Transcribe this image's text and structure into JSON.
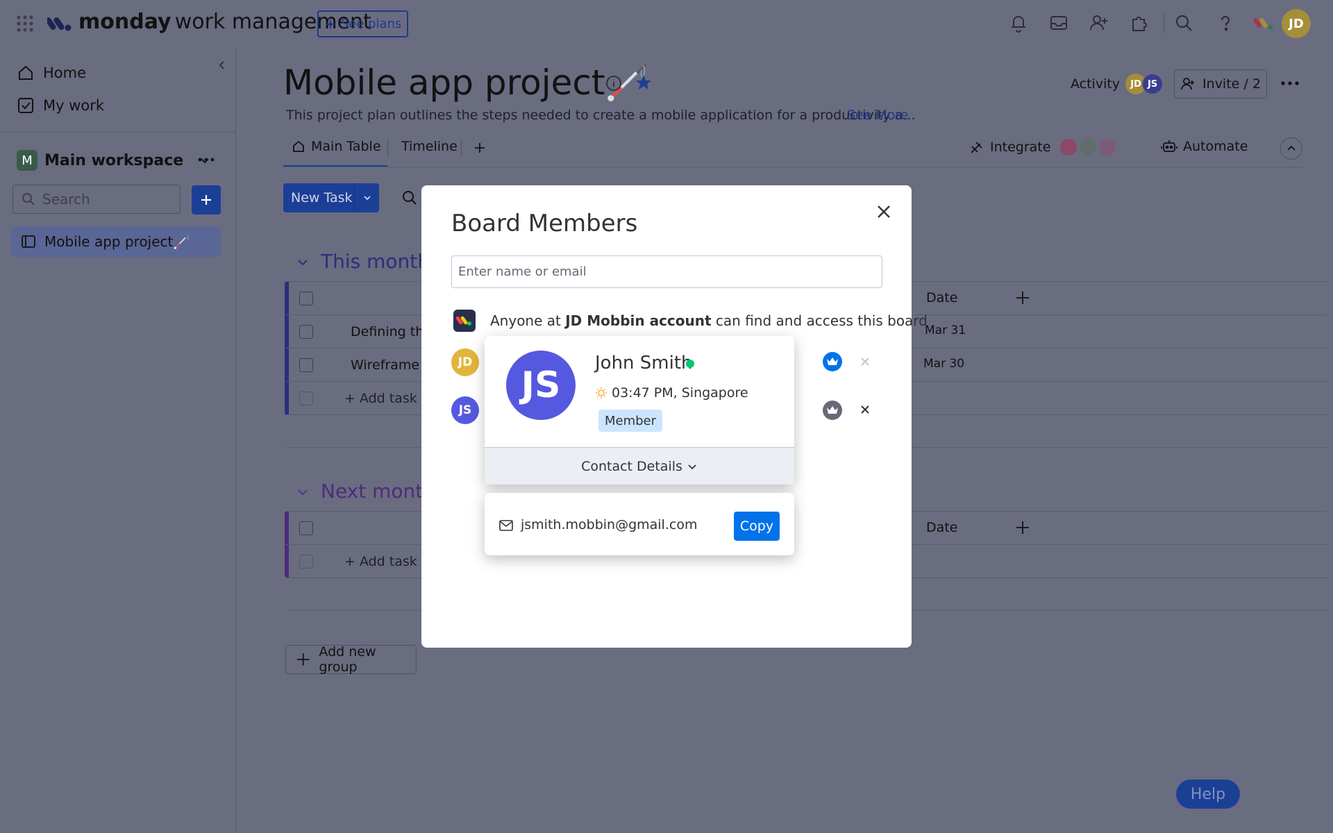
{
  "topbar": {
    "brand_bold": "monday",
    "brand_light": "work management",
    "see_plans": "See plans",
    "user_initials": "JD"
  },
  "sidebar": {
    "home": "Home",
    "my_work": "My work",
    "workspace_initial": "M",
    "workspace_name": "Main workspace",
    "search_placeholder": "Search",
    "board_item": "Mobile app project🦯"
  },
  "board": {
    "title": "Mobile app project🦯",
    "description": "This project plan outlines the steps needed to create a mobile application for a productivity a...",
    "see_more": "See More",
    "activity": "Activity",
    "invite": "Invite / 2",
    "tabs": [
      "Main Table",
      "Timeline"
    ],
    "integrate": "Integrate",
    "automate": "Automate",
    "new_task": "New Task",
    "groups": [
      {
        "title": "This month",
        "date_header": "Date",
        "rows": [
          {
            "name": "Defining the",
            "date": "Mar 31"
          },
          {
            "name": "Wireframe a",
            "date": "Mar 30"
          }
        ],
        "add_task": "+ Add task"
      },
      {
        "title": "Next month",
        "date_header": "Date",
        "add_task": "+ Add task"
      }
    ],
    "add_group": "Add new group",
    "help": "Help"
  },
  "modal": {
    "title": "Board Members",
    "input_placeholder": "Enter name or email",
    "account_prefix": "Anyone at ",
    "account_name": "JD Mobbin account",
    "account_suffix": " can find and access this board",
    "members": [
      {
        "initials": "JD",
        "color": "#e2b43b"
      },
      {
        "initials": "JS",
        "color": "#5559df"
      }
    ]
  },
  "profile": {
    "initials": "JS",
    "name": "John Smith",
    "time_location": "03:47 PM, Singapore",
    "role": "Member",
    "contact_details": "Contact Details",
    "email": "jsmith.mobbin@gmail.com",
    "copy": "Copy"
  }
}
